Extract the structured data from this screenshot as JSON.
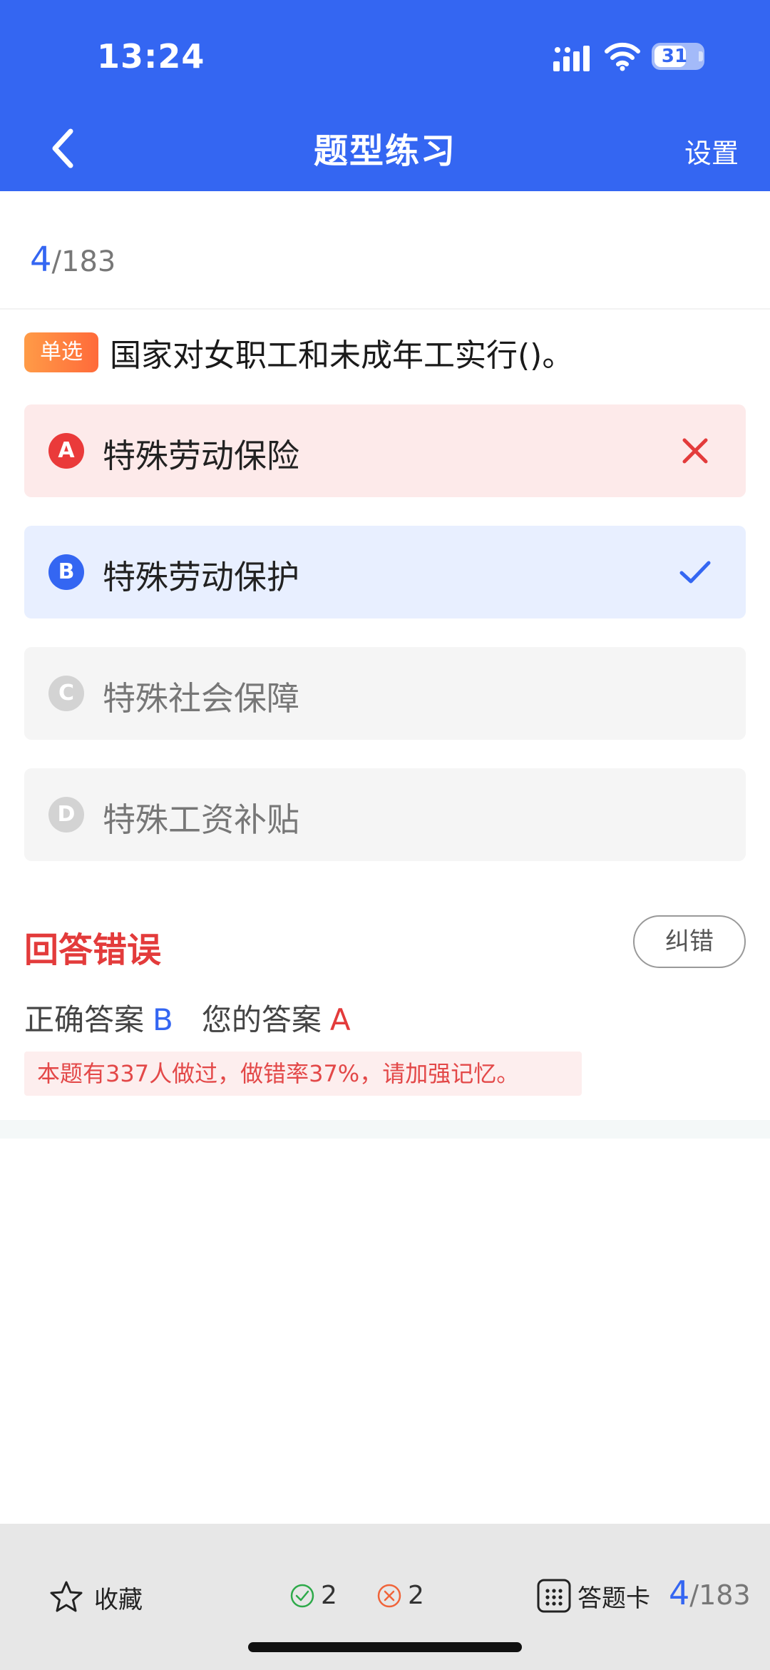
{
  "status_bar": {
    "time": "13:24",
    "battery": "31"
  },
  "nav": {
    "title": "题型练习",
    "settings_label": "设置"
  },
  "progress": {
    "current": "4",
    "total": "/183"
  },
  "question": {
    "type_label": "单选",
    "text": "国家对女职工和未成年工实行()。"
  },
  "options": [
    {
      "letter": "A",
      "text": "特殊劳动保险",
      "state": "wrong"
    },
    {
      "letter": "B",
      "text": "特殊劳动保护",
      "state": "correct"
    },
    {
      "letter": "C",
      "text": "特殊社会保障",
      "state": "none"
    },
    {
      "letter": "D",
      "text": "特殊工资补贴",
      "state": "none"
    }
  ],
  "result": {
    "title": "回答错误",
    "report_label": "纠错",
    "correct_label": "正确答案",
    "correct_value": "B",
    "yours_label": "您的答案",
    "yours_value": "A",
    "stat_text": "本题有337人做过，做错率37%，请加强记忆。"
  },
  "bottom": {
    "favorite_label": "收藏",
    "right_count": "2",
    "wrong_count": "2",
    "card_label": "答题卡",
    "progress_current": "4",
    "progress_total": "/183"
  },
  "colors": {
    "primary": "#3466f2",
    "error": "#e33b3b",
    "success": "#2eaa4a"
  }
}
